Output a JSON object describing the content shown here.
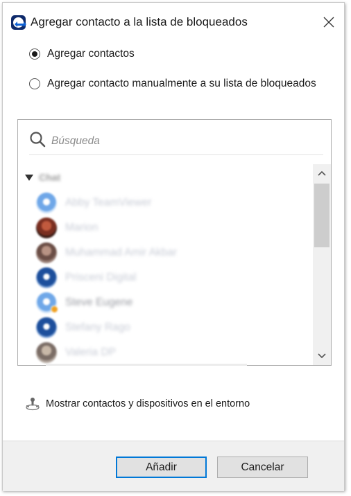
{
  "window": {
    "title": "Agregar contacto a la lista de bloqueados",
    "close_icon": "close-icon"
  },
  "options": [
    {
      "label": "Agregar contactos",
      "checked": true
    },
    {
      "label": "Agregar contacto manualmente a su lista de bloqueados",
      "checked": false
    }
  ],
  "search": {
    "placeholder": "Búsqueda",
    "value": ""
  },
  "group": {
    "name": "Chat",
    "expanded": true
  },
  "contacts": [
    {
      "name": "Abby TeamViewer"
    },
    {
      "name": "Marion"
    },
    {
      "name": "Muhammad Amir Akbar"
    },
    {
      "name": "Prisceni Digital"
    },
    {
      "name": "Steve Eugene"
    },
    {
      "name": "Stefany Rago"
    },
    {
      "name": "Valeria DP"
    }
  ],
  "environment_link": {
    "label": "Mostrar contactos y dispositivos en el entorno"
  },
  "footer": {
    "ok_label": "Añadir",
    "cancel_label": "Cancelar"
  },
  "colors": {
    "accent": "#0078d7",
    "brand": "#0e2a6b",
    "status_away": "#f0a020"
  }
}
